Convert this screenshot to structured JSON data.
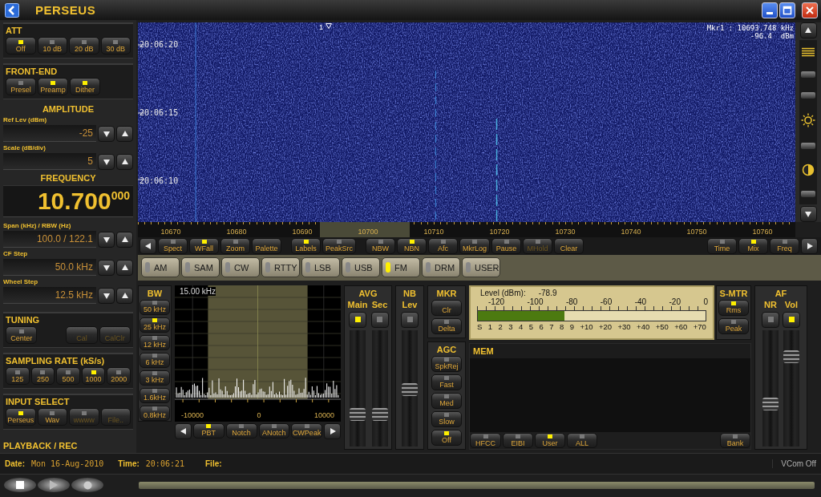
{
  "window": {
    "title": "PERSEUS"
  },
  "att": {
    "title": "ATT",
    "buttons": [
      {
        "label": "Off",
        "on": true
      },
      {
        "label": "10 dB",
        "on": false
      },
      {
        "label": "20 dB",
        "on": false
      },
      {
        "label": "30 dB",
        "on": false
      }
    ]
  },
  "front_end": {
    "title": "FRONT-END",
    "buttons": [
      {
        "label": "Presel",
        "on": false
      },
      {
        "label": "Preamp",
        "on": true
      },
      {
        "label": "Dither",
        "on": true
      }
    ]
  },
  "amplitude": {
    "title": "AMPLITUDE",
    "fields": [
      {
        "label": "Ref Lev (dBm)",
        "value": "-25"
      },
      {
        "label": "Scale (dB/div)",
        "value": "5"
      }
    ]
  },
  "frequency": {
    "title": "FREQUENCY",
    "display": "10.700$^{000}$",
    "fields": [
      {
        "label": "Span (kHz) / RBW (Hz)",
        "value": "100.0 / 122.1"
      },
      {
        "label": "CF Step",
        "value": "50.0 kHz"
      },
      {
        "label": "Wheel Step",
        "value": "12.5 kHz"
      }
    ]
  },
  "tuning": {
    "title": "TUNING",
    "buttons": [
      {
        "label": "Center",
        "kind": "led",
        "on": false,
        "disabled": false
      },
      {
        "label": "Cal",
        "kind": "plain",
        "disabled": true
      },
      {
        "label": "CalClr",
        "kind": "plain",
        "disabled": true
      }
    ]
  },
  "sampling_rate": {
    "title": "SAMPLING RATE (kS/s)",
    "buttons": [
      {
        "label": "125",
        "on": false
      },
      {
        "label": "250",
        "on": false
      },
      {
        "label": "500",
        "on": false
      },
      {
        "label": "1000",
        "on": true
      },
      {
        "label": "2000",
        "on": false
      }
    ]
  },
  "input_select": {
    "title": "INPUT SELECT",
    "buttons": [
      {
        "label": "Perseus",
        "kind": "led",
        "on": true,
        "disabled": false
      },
      {
        "label": "Wav",
        "kind": "led",
        "on": false,
        "disabled": false
      },
      {
        "label": "wwww",
        "kind": "led",
        "on": false,
        "disabled": true
      },
      {
        "label": "File..",
        "kind": "plain",
        "disabled": true
      }
    ]
  },
  "playback": {
    "title": "PLAYBACK / REC"
  },
  "waterfall": {
    "times": [
      "20:06:20",
      "20:06:15",
      "20:06:10"
    ],
    "marker": "1",
    "marker_readout": [
      "Mkr1 : 10693.748 kHz",
      "-96.4  dBm"
    ]
  },
  "freq_axis": [
    "10670",
    "10680",
    "10690",
    "10700",
    "10710",
    "10720",
    "10730",
    "10740",
    "10750",
    "10760"
  ],
  "toolbar": [
    {
      "label": "Spect",
      "kind": "led",
      "on": false,
      "disabled": false
    },
    {
      "label": "WFall",
      "kind": "led",
      "on": true,
      "disabled": false
    },
    {
      "label": "Zoom",
      "kind": "led",
      "on": false,
      "disabled": false
    },
    {
      "label": "Palette",
      "kind": "plain",
      "disabled": false
    },
    {
      "label": "Labels",
      "kind": "led",
      "on": true,
      "disabled": false
    },
    {
      "label": "PeakSrc",
      "kind": "led",
      "on": false,
      "disabled": false
    },
    {
      "label": "NBW",
      "kind": "led",
      "on": false,
      "disabled": false
    },
    {
      "label": "NBN",
      "kind": "led",
      "on": true,
      "disabled": false
    },
    {
      "label": "Afc",
      "kind": "led",
      "on": false,
      "disabled": false
    },
    {
      "label": "MkrLog",
      "kind": "led",
      "on": false,
      "disabled": false
    },
    {
      "label": "Pause",
      "kind": "led",
      "on": false,
      "disabled": false
    },
    {
      "label": "MHold",
      "kind": "led",
      "on": false,
      "disabled": true
    },
    {
      "label": "Clear",
      "kind": "plain",
      "disabled": false
    }
  ],
  "toolbar_right": [
    {
      "label": "Time",
      "on": false
    },
    {
      "label": "Mix",
      "on": true
    },
    {
      "label": "Freq",
      "on": false
    }
  ],
  "modes": [
    {
      "label": "AM",
      "selected": false
    },
    {
      "label": "SAM",
      "selected": false
    },
    {
      "label": "CW",
      "selected": false
    },
    {
      "label": "RTTY",
      "selected": false
    },
    {
      "label": "LSB",
      "selected": false
    },
    {
      "label": "USB",
      "selected": false
    },
    {
      "label": "FM",
      "selected": true
    },
    {
      "label": "DRM",
      "selected": false
    },
    {
      "label": "USER",
      "selected": false
    }
  ],
  "bw": {
    "title": "BW",
    "buttons": [
      {
        "label": "50 kHz",
        "on": false
      },
      {
        "label": "25 kHz",
        "on": true
      },
      {
        "label": "12 kHz",
        "on": false
      },
      {
        "label": "6 kHz",
        "on": false
      },
      {
        "label": "3 kHz",
        "on": false
      },
      {
        "label": "1.6kHz",
        "on": false
      },
      {
        "label": "0.8kHz",
        "on": false
      }
    ]
  },
  "filter_display": {
    "readout": "15.00 kHz",
    "axis": [
      "-10000",
      "0",
      "10000"
    ]
  },
  "filter_buttons": [
    {
      "label": "PBT",
      "on": true
    },
    {
      "label": "Notch",
      "on": false
    },
    {
      "label": "ANotch",
      "on": false
    },
    {
      "label": "CWPeak",
      "on": false
    }
  ],
  "avg": {
    "title": "AVG",
    "channels": [
      {
        "label": "Main",
        "on": true,
        "level": 0.25
      },
      {
        "label": "Sec",
        "on": false,
        "level": 0.25
      }
    ]
  },
  "nb": {
    "title": "NB",
    "channels": [
      {
        "label": "Lev",
        "on": false,
        "level": 0.49
      }
    ]
  },
  "mkr": {
    "title": "MKR",
    "buttons": [
      {
        "label": "Clr",
        "kind": "plain"
      },
      {
        "label": "Delta",
        "kind": "led",
        "on": false
      }
    ]
  },
  "agc": {
    "title": "AGC",
    "buttons": [
      {
        "label": "SpkRej",
        "on": false
      },
      {
        "label": "Fast",
        "on": false
      },
      {
        "label": "Med",
        "on": false
      },
      {
        "label": "Slow",
        "on": false
      },
      {
        "label": "Off",
        "on": true
      }
    ]
  },
  "s_meter": {
    "label": "Level (dBm):",
    "reading": "-78.9",
    "scale": [
      "-120",
      "-100",
      "-80",
      "-60",
      "-40",
      "-20",
      "0"
    ],
    "s_scale": [
      "S",
      "1",
      "2",
      "3",
      "4",
      "5",
      "6",
      "7",
      "8",
      "9",
      "+10",
      "+20",
      "+30",
      "+40",
      "+50",
      "+60",
      "+70"
    ],
    "level": 0.38
  },
  "s_mtr": {
    "title": "S-MTR",
    "buttons": [
      {
        "label": "Rms",
        "on": true
      },
      {
        "label": "Peak",
        "on": false
      }
    ]
  },
  "mem": {
    "title": "MEM",
    "buttons": [
      {
        "label": "HFCC",
        "on": false
      },
      {
        "label": "EIBI",
        "on": false
      },
      {
        "label": "User",
        "on": true
      },
      {
        "label": "ALL",
        "on": false
      }
    ],
    "bank": {
      "label": "Bank",
      "on": false
    }
  },
  "af": {
    "title": "AF",
    "channels": [
      {
        "label": "NR",
        "on": false,
        "level": 0.35
      },
      {
        "label": "Vol",
        "on": true,
        "level": 0.81
      }
    ]
  },
  "status_bar": {
    "date_label": "Date:",
    "date": "Mon 16-Aug-2010",
    "time_label": "Time:",
    "time": "20:06:21",
    "file_label": "File:",
    "vcom": "VCom Off"
  }
}
